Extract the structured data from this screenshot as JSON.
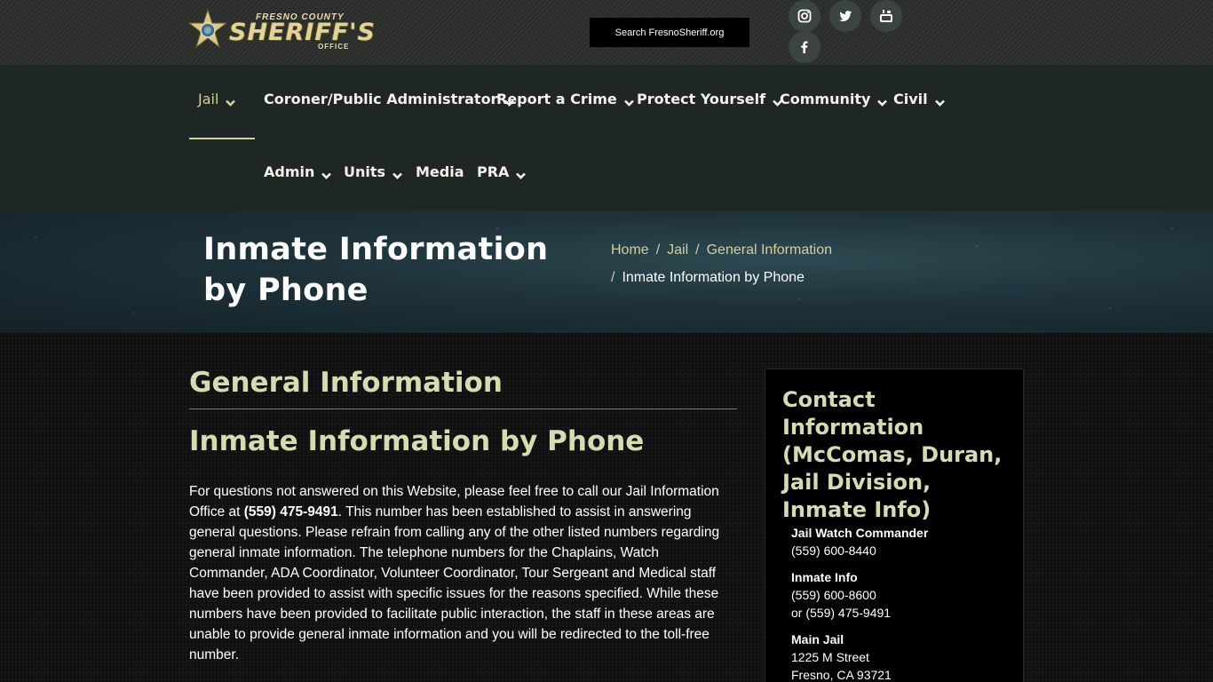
{
  "header": {
    "logo_county": "FRESNO COUNTY",
    "logo_sheriff": "SHERIFF'S",
    "logo_office": "OFFICE",
    "search_label": "Search FresnoSheriff.org",
    "social": [
      {
        "icon": "instagram-icon"
      },
      {
        "icon": "twitter-icon"
      },
      {
        "icon": "youtube-icon"
      },
      {
        "icon": "facebook-icon"
      }
    ]
  },
  "nav": {
    "items": [
      {
        "label": "Jail"
      },
      {
        "label": "Coroner/Public Administrator"
      },
      {
        "label": "Report a Crime"
      },
      {
        "label": "Protect Yourself"
      },
      {
        "label": "Community"
      },
      {
        "label": "Civil"
      },
      {
        "label": "Admin"
      },
      {
        "label": "Units"
      },
      {
        "label": "Media"
      },
      {
        "label": "PRA"
      }
    ]
  },
  "banner": {
    "title": "Inmate Information by Phone",
    "breadcrumb": [
      "Home",
      "Jail",
      "General Information",
      "Inmate Information by Phone"
    ]
  },
  "main": {
    "section_title": "General Information",
    "article_title": "Inmate Information by Phone",
    "body_before": "For questions not answered on this Website, please feel free to call our Jail Information Office at ",
    "body_phone": "(559) 475-9491",
    "body_after": ". This number has been established to assist in answering general questions. Please refrain from calling any of the other listed numbers regarding general inmate information. The telephone numbers for the Chaplains, Watch Commander, ADA Coordinator, Volunteer Coordinator, Tour Sergeant and Medical staff have been provided to assist with specific issues for the reasons specified. While these numbers have been provided to facilitate public interaction, the staff in these areas are unable to provide general inmate information and you will be redirected to the toll-free number."
  },
  "sidebar": {
    "title": "Contact Information (McComas, Duran, Jail Division, Inmate Info)",
    "contacts": [
      {
        "label": "Jail Watch Commander",
        "line1": "(559) 600-8440"
      },
      {
        "label": "Inmate Info",
        "line1": "(559) 600-8600",
        "line2": "or (559) 475-9491"
      },
      {
        "label": "Main Jail",
        "line1": "1225 M Street",
        "line2": "Fresno, CA  93721"
      }
    ]
  },
  "colors": {
    "accent": "#d6cf9a",
    "heading": "#d6dcb2",
    "nav_bg": "#1e2723"
  }
}
